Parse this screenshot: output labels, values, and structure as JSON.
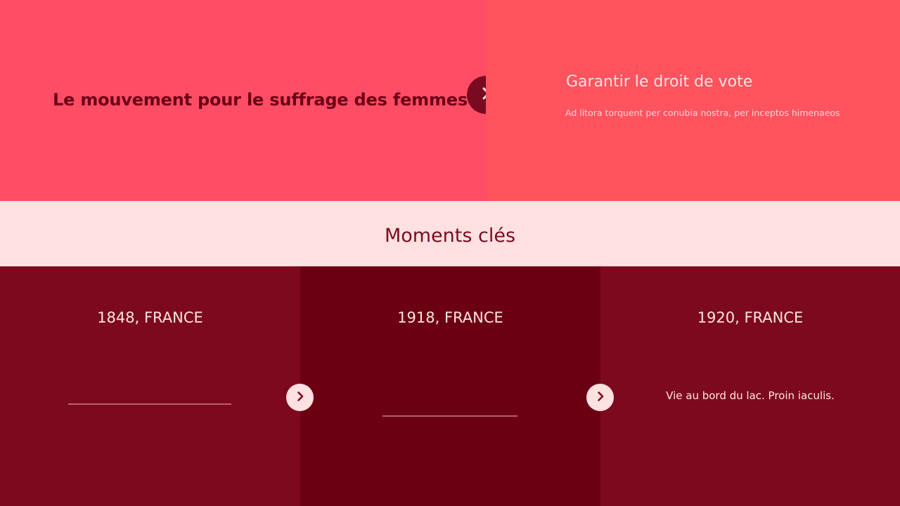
{
  "hero": {
    "title": "Le mouvement pour le suffrage des femmes",
    "right_title": "Garantir le droit de vote",
    "right_text": "Ad litora torquent per conubia nostra, per inceptos himenaeos"
  },
  "moments": {
    "title": "Moments clés"
  },
  "columns": [
    {
      "title": "1848, FRANCE"
    },
    {
      "title": "1918, FRANCE"
    },
    {
      "title": "1920, FRANCE",
      "text": "Vie au bord du lac. Proin iaculis."
    }
  ],
  "icons": {
    "hero_arrow": "chevron-right-icon",
    "next_1": "chevron-right-icon",
    "next_2": "chevron-right-icon"
  },
  "colors": {
    "hero_left": "#ff4d65",
    "hero_right": "#ff535e",
    "moments_band": "#ffe1e1",
    "dark_red": "#7d091e",
    "darker_red": "#6b0013"
  }
}
